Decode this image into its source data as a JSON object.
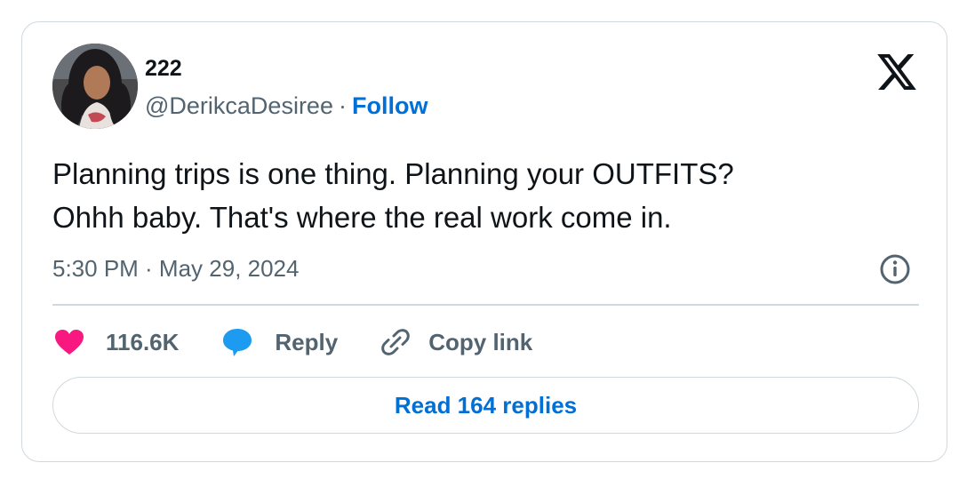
{
  "author": {
    "display_name": "222",
    "handle": "@DerikcaDesiree",
    "separator": "·",
    "follow_label": "Follow"
  },
  "tweet": {
    "line1": "Planning trips is one thing. Planning your OUTFITS?",
    "line2": "Ohhh baby. That's where the real work come in.",
    "timestamp": "5:30 PM · May 29, 2024"
  },
  "actions": {
    "likes_count": "116.6K",
    "reply_label": "Reply",
    "copy_link_label": "Copy link"
  },
  "read_replies_label": "Read 164 replies",
  "icons": {
    "brand": "x-logo-icon",
    "info": "info-icon",
    "like": "heart-icon",
    "reply": "speech-bubble-icon",
    "copy": "link-icon"
  },
  "colors": {
    "link_blue": "#006fd6",
    "heart_pink": "#f91880",
    "reply_blue": "#1d9bf0",
    "muted_text": "#536471",
    "border": "#cfd9de"
  }
}
